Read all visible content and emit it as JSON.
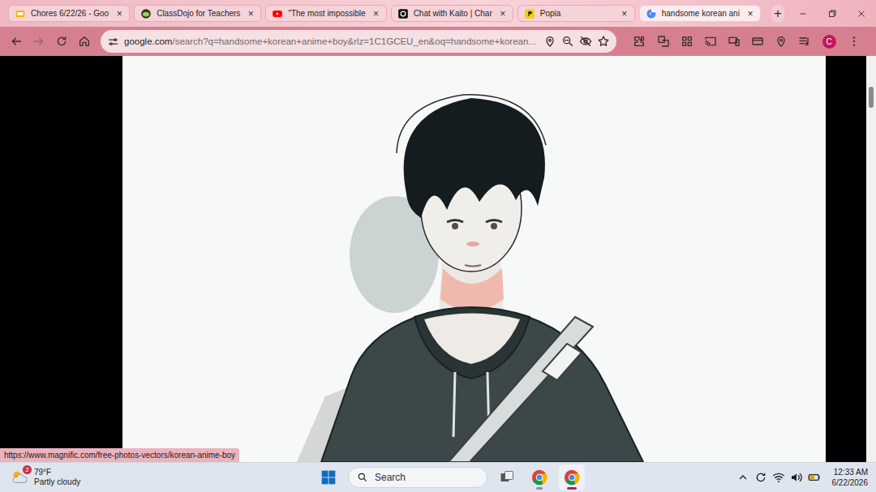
{
  "tabs": [
    {
      "label": "Chores 6/22/26 - Goo",
      "close": "×",
      "selected": false
    },
    {
      "label": "ClassDojo for Teachers",
      "close": "×",
      "selected": false
    },
    {
      "label": "\"The most impossible",
      "close": "×",
      "selected": false
    },
    {
      "label": "Chat with Kaito | Char",
      "close": "×",
      "selected": false
    },
    {
      "label": "Popia",
      "close": "×",
      "selected": false
    },
    {
      "label": "handsome korean ani",
      "close": "×",
      "selected": true
    }
  ],
  "new_tab": "+",
  "address_bar": {
    "domain": "google.com",
    "path": "/search?q=handsome+korean+anime+boy&rlz=1C1GCEU_en&oq=handsome+korean..."
  },
  "profile": "C",
  "status_link": "https://www.magnific.com/free-photos-vectors/korean-anime-boy",
  "taskbar": {
    "weather": {
      "badge": "2",
      "temp": "79°F",
      "condition": "Partly cloudy"
    },
    "search": "Search",
    "apps": [
      {
        "selected": false
      },
      {
        "selected": true
      }
    ],
    "time": "12:33 AM",
    "date": "6/22/2026"
  }
}
